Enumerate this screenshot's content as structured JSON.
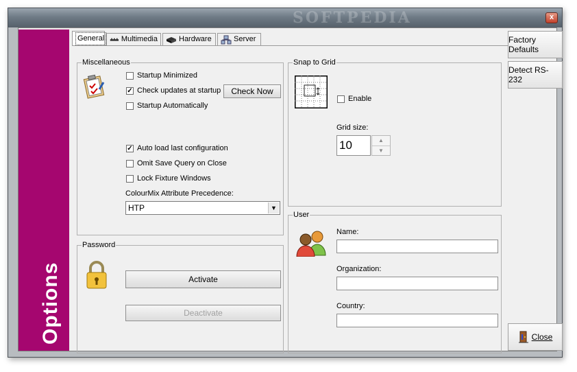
{
  "window": {
    "watermark": "SOFTPEDIA",
    "close_glyph": "x"
  },
  "sidebar": {
    "title": "Options",
    "color": "#a5066f"
  },
  "tabs": [
    {
      "label": "General",
      "icon": "settings-icon",
      "active": true
    },
    {
      "label": "Multimedia",
      "icon": "multimedia-icon",
      "active": false
    },
    {
      "label": "Hardware",
      "icon": "hardware-icon",
      "active": false
    },
    {
      "label": "Server",
      "icon": "server-icon",
      "active": false
    }
  ],
  "misc": {
    "title": "Miscellaneous",
    "startup_minimized": {
      "label": "Startup Minimized",
      "checked": false
    },
    "check_updates": {
      "label": "Check updates at startup",
      "checked": true
    },
    "check_now": "Check Now",
    "startup_auto": {
      "label": "Startup Automatically",
      "checked": false
    },
    "auto_load": {
      "label": "Auto load last configuration",
      "checked": true
    },
    "omit_save": {
      "label": "Omit Save Query on Close",
      "checked": false
    },
    "lock_fixture": {
      "label": "Lock Fixture Windows",
      "checked": false
    },
    "colourmix_label": "ColourMix Attribute Precedence:",
    "colourmix_value": "HTP"
  },
  "password": {
    "title": "Password",
    "activate": "Activate",
    "deactivate": "Deactivate"
  },
  "snap": {
    "title": "Snap to Grid",
    "enable": {
      "label": "Enable",
      "checked": false
    },
    "grid_size_label": "Grid size:",
    "grid_size_value": "10"
  },
  "user": {
    "title": "User",
    "name_label": "Name:",
    "org_label": "Organization:",
    "country_label": "Country:"
  },
  "actions": {
    "factory_defaults": "Factory Defaults",
    "detect_rs232": "Detect RS-232",
    "close": "Close"
  }
}
